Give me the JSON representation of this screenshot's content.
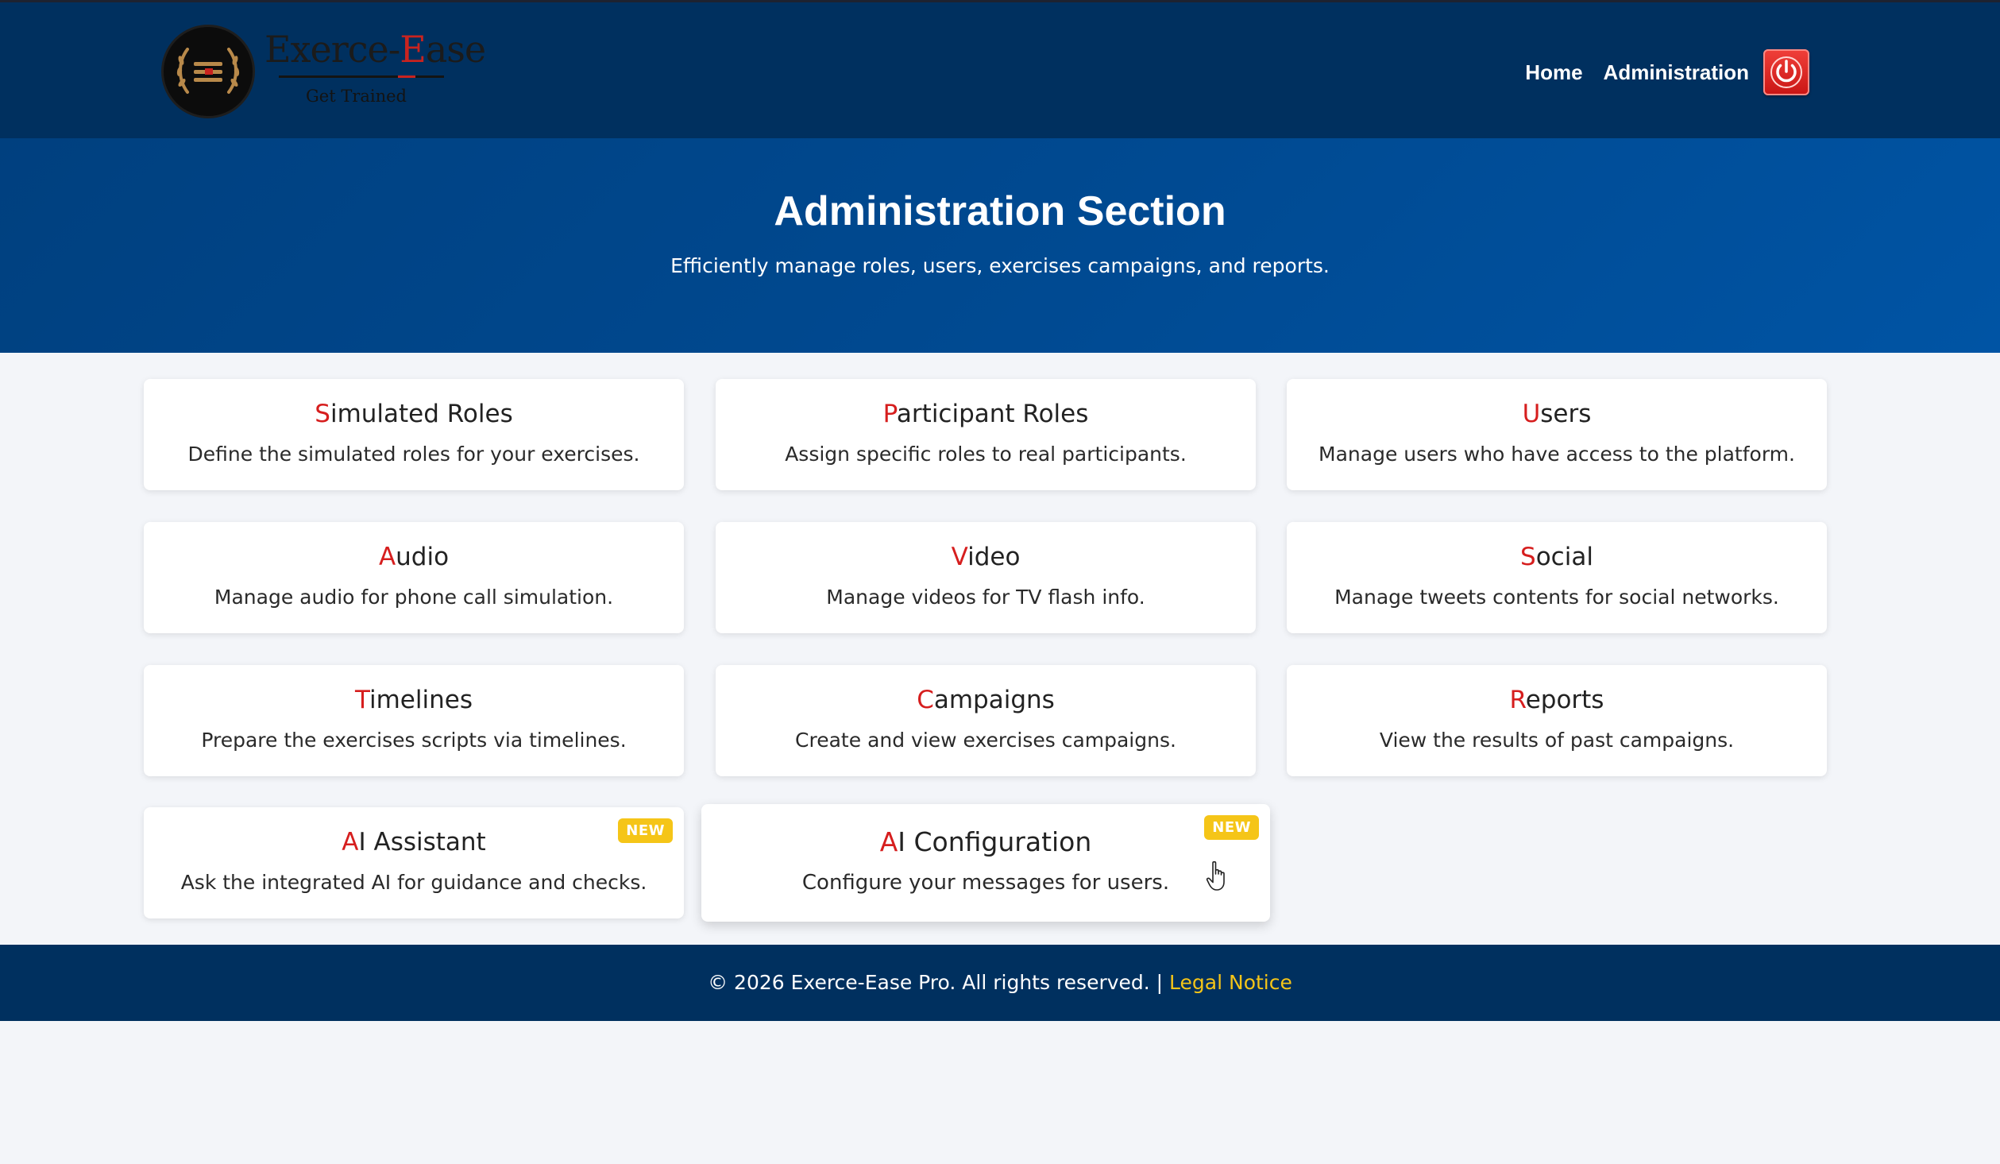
{
  "brand": {
    "name_prefix": "Exerce-",
    "name_initial": "E",
    "name_rest": "ase",
    "tagline": "Get Trained",
    "emblem_icon": "laurel-wreath-emblem-icon"
  },
  "nav": {
    "links": [
      "Home",
      "Administration"
    ],
    "logout_icon": "power-icon"
  },
  "hero": {
    "title": "Administration Section",
    "subtitle": "Efficiently manage roles, users, exercises campaigns, and reports."
  },
  "cards": [
    {
      "initial": "S",
      "rest": "imulated Roles",
      "desc": "Define the simulated roles for your exercises.",
      "badge": ""
    },
    {
      "initial": "P",
      "rest": "articipant Roles",
      "desc": "Assign specific roles to real participants.",
      "badge": ""
    },
    {
      "initial": "U",
      "rest": "sers",
      "desc": "Manage users who have access to the platform.",
      "badge": ""
    },
    {
      "initial": "A",
      "rest": "udio",
      "desc": "Manage audio for phone call simulation.",
      "badge": ""
    },
    {
      "initial": "V",
      "rest": "ideo",
      "desc": "Manage videos for TV flash info.",
      "badge": ""
    },
    {
      "initial": "S",
      "rest": "ocial",
      "desc": "Manage tweets contents for social networks.",
      "badge": ""
    },
    {
      "initial": "T",
      "rest": "imelines",
      "desc": "Prepare the exercises scripts via timelines.",
      "badge": ""
    },
    {
      "initial": "C",
      "rest": "ampaigns",
      "desc": "Create and view exercises campaigns.",
      "badge": ""
    },
    {
      "initial": "R",
      "rest": "eports",
      "desc": "View the results of past campaigns.",
      "badge": ""
    },
    {
      "initial": "A",
      "rest": "I Assistant",
      "desc": "Ask the integrated AI for guidance and checks.",
      "badge": "NEW"
    },
    {
      "initial": "A",
      "rest": "I Configuration",
      "desc": "Configure your messages for users.",
      "badge": "NEW"
    }
  ],
  "footer": {
    "text": "© 2026 Exerce-Ease Pro. All rights reserved. | ",
    "link": "Legal Notice"
  },
  "colors": {
    "header_bg": "#00305f",
    "hero_bg": "#004a92",
    "accent_red": "#d61e1e",
    "badge_yellow": "#f5c518",
    "link_yellow": "#f5c518"
  }
}
